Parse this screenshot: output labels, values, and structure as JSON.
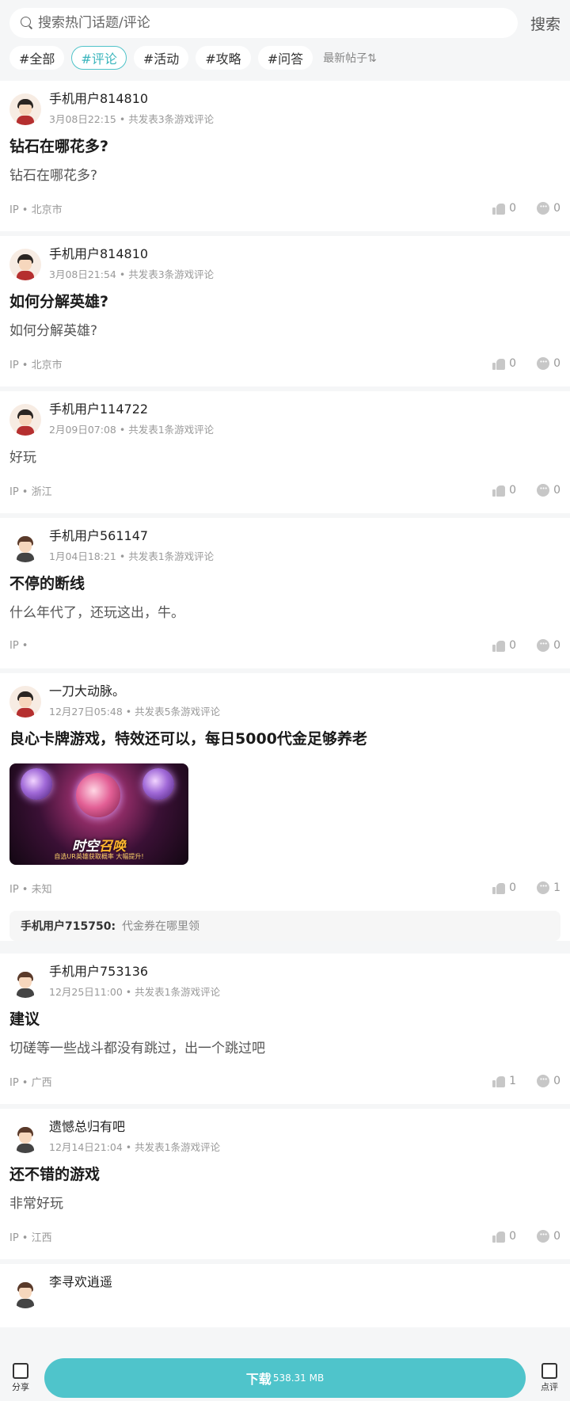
{
  "search": {
    "placeholder": "搜索热门话题/评论",
    "button": "搜索"
  },
  "tags": [
    "#全部",
    "#评论",
    "#活动",
    "#攻略",
    "#问答"
  ],
  "active_tag": 1,
  "sort_label": "最新帖子⇅",
  "posts": [
    {
      "author": "手机用户814810",
      "meta": "3月08日22:15 • 共发表3条游戏评论",
      "title": "钻石在哪花多?",
      "body": "钻石在哪花多?",
      "ip": "IP • 北京市",
      "likes": "0",
      "comments": "0"
    },
    {
      "author": "手机用户814810",
      "meta": "3月08日21:54 • 共发表3条游戏评论",
      "title": "如何分解英雄?",
      "body": "如何分解英雄?",
      "ip": "IP • 北京市",
      "likes": "0",
      "comments": "0"
    },
    {
      "author": "手机用户114722",
      "meta": "2月09日07:08 • 共发表1条游戏评论",
      "body": "好玩",
      "ip": "IP • 浙江",
      "likes": "0",
      "comments": "0"
    },
    {
      "author": "手机用户561147",
      "meta": "1月04日18:21 • 共发表1条游戏评论",
      "title": "不停的断线",
      "body": "什么年代了，还玩这出，牛。",
      "ip": "IP •",
      "likes": "0",
      "comments": "0"
    },
    {
      "author": "一刀大动脉。",
      "meta": "12月27日05:48 • 共发表5条游戏评论",
      "title": "良心卡牌游戏，特效还可以，每日5000代金足够养老",
      "image_title_a": "时空",
      "image_title_b": "召唤",
      "image_sub": "自选UR英雄获取概率 大幅提升!",
      "ip": "IP • 未知",
      "likes": "0",
      "comments": "1",
      "reply_name": "手机用户715750:",
      "reply_text": "代金券在哪里领"
    },
    {
      "author": "手机用户753136",
      "meta": "12月25日11:00 • 共发表1条游戏评论",
      "title": "建议",
      "body": "切磋等一些战斗都没有跳过，出一个跳过吧",
      "ip": "IP • 广西",
      "likes": "1",
      "comments": "0"
    },
    {
      "author": "遗憾总归有吧",
      "meta": "12月14日21:04 • 共发表1条游戏评论",
      "title": "还不错的游戏",
      "body": "非常好玩",
      "ip": "IP • 江西",
      "likes": "0",
      "comments": "0"
    },
    {
      "author": "李寻欢逍遥"
    }
  ],
  "bottom": {
    "share": "分享",
    "download": "下载",
    "size": "538.31 MB",
    "review": "点评"
  },
  "colors": {
    "accent": "#4fc4cb"
  }
}
